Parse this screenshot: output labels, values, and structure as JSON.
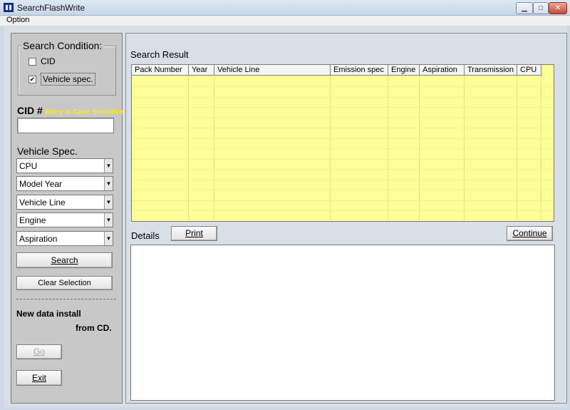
{
  "window": {
    "title": "SearchFlashWrite"
  },
  "menu": {
    "items": [
      "Option"
    ]
  },
  "search_condition": {
    "title": "Search Condition:",
    "cid_label": "CID",
    "cid_checked": false,
    "vehicle_label": "Vehicle spec.",
    "vehicle_checked": true
  },
  "cid": {
    "label": "CID #",
    "hint": "Entry is Case Sensitive",
    "value": ""
  },
  "vehicle_spec": {
    "label": "Vehicle Spec.",
    "selects": [
      "CPU",
      "Model Year",
      "Vehicle Line",
      "Engine",
      "Aspiration"
    ]
  },
  "buttons": {
    "search": "Search",
    "clear": "Clear Selection",
    "go": "Go",
    "exit": "Exit",
    "print": "Print",
    "continue": "Continue"
  },
  "install": {
    "line1": "New data install",
    "line2": "from CD."
  },
  "results": {
    "title": "Search Result",
    "columns": [
      "Pack Number",
      "Year",
      "Vehicle Line",
      "Emission spec",
      "Engine",
      "Aspiration",
      "Transmission",
      "CPU"
    ]
  },
  "details": {
    "title": "Details"
  },
  "colors": {
    "grid_bg": "#ffff99",
    "hint": "#ffe81a",
    "panel_bg": "#c8c8c8"
  }
}
